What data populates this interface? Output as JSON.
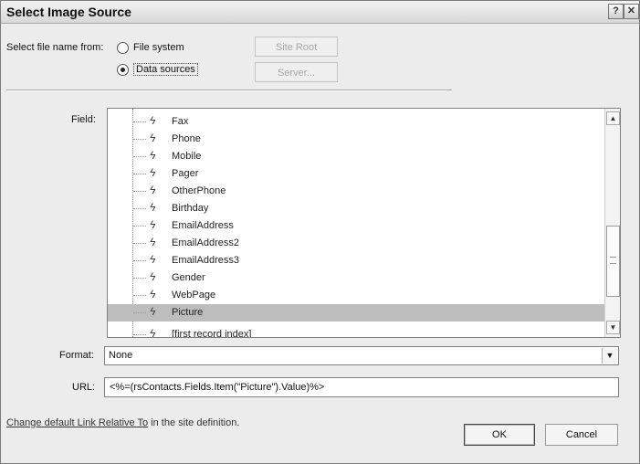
{
  "window": {
    "title": "Select Image Source",
    "help_icon": "?",
    "close_icon": "✕"
  },
  "source": {
    "label": "Select file name from:",
    "options": [
      {
        "label": "File system",
        "selected": false
      },
      {
        "label": "Data sources",
        "selected": true
      }
    ],
    "site_root_button": "Site Root",
    "server_button": "Server..."
  },
  "field": {
    "label": "Field:",
    "items": [
      {
        "label": "Fax",
        "selected": false
      },
      {
        "label": "Phone",
        "selected": false
      },
      {
        "label": "Mobile",
        "selected": false
      },
      {
        "label": "Pager",
        "selected": false
      },
      {
        "label": "OtherPhone",
        "selected": false
      },
      {
        "label": "Birthday",
        "selected": false
      },
      {
        "label": "EmailAddress",
        "selected": false
      },
      {
        "label": "EmailAddress2",
        "selected": false
      },
      {
        "label": "EmailAddress3",
        "selected": false
      },
      {
        "label": "Gender",
        "selected": false
      },
      {
        "label": "WebPage",
        "selected": false
      },
      {
        "label": "Picture",
        "selected": true
      },
      {
        "label": "[first record index]",
        "selected": false
      }
    ],
    "scroll_up_icon": "▲",
    "scroll_down_icon": "▼"
  },
  "format": {
    "label": "Format:",
    "value": "None",
    "dropdown_icon": "▼"
  },
  "url": {
    "label": "URL:",
    "value": "<%=(rsContacts.Fields.Item(\"Picture\").Value)%>"
  },
  "footer": {
    "link_text": "Change default Link Relative To",
    "suffix_text": " in the site definition.",
    "ok_button": "OK",
    "cancel_button": "Cancel"
  }
}
